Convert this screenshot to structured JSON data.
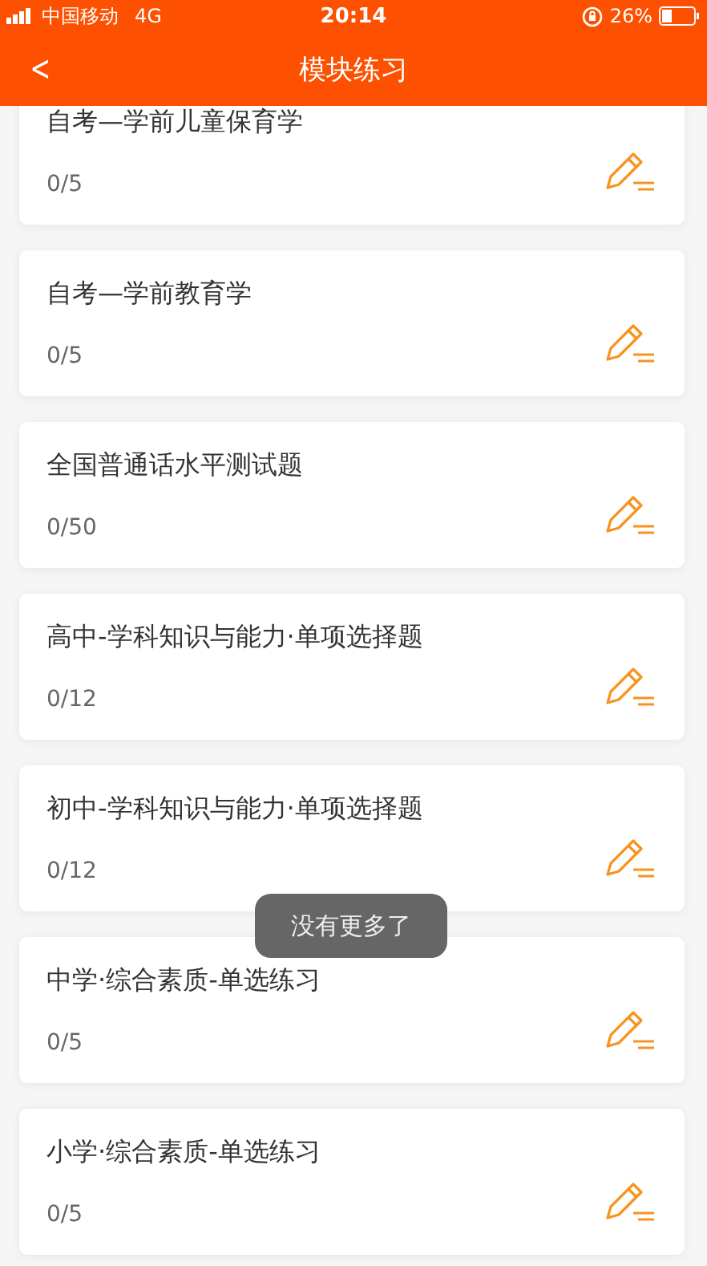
{
  "status_bar": {
    "carrier": "中国移动",
    "network": "4G",
    "time": "20:14",
    "battery": "26%"
  },
  "header": {
    "back": "<",
    "title": "模块练习"
  },
  "modules": [
    {
      "title": "自考—学前儿童保育学",
      "progress": "0/5"
    },
    {
      "title": "自考—学前教育学",
      "progress": "0/5"
    },
    {
      "title": "全国普通话水平测试题",
      "progress": "0/50"
    },
    {
      "title": "高中-学科知识与能力·单项选择题",
      "progress": "0/12"
    },
    {
      "title": "初中-学科知识与能力·单项选择题",
      "progress": "0/12"
    },
    {
      "title": "中学·综合素质-单选练习",
      "progress": "0/5"
    },
    {
      "title": "小学·综合素质-单选练习",
      "progress": "0/5"
    }
  ],
  "toast": "没有更多了"
}
